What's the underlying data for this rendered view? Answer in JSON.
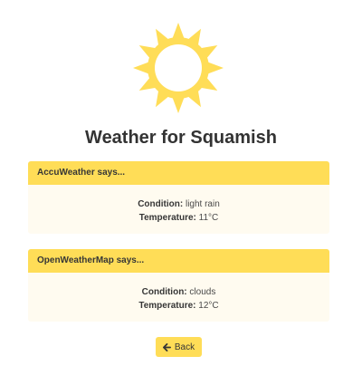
{
  "page": {
    "title": "Weather for Squamish",
    "icon": "sun-icon",
    "accent_color": "#ffdd57"
  },
  "providers": [
    {
      "header": "AccuWeather says...",
      "condition_label": "Condition:",
      "condition": "light rain",
      "temperature_label": "Temperature:",
      "temperature": "11°C"
    },
    {
      "header": "OpenWeatherMap says...",
      "condition_label": "Condition:",
      "condition": "clouds",
      "temperature_label": "Temperature:",
      "temperature": "12°C"
    }
  ],
  "back_button": {
    "label": "Back",
    "icon": "arrow-left-icon"
  }
}
